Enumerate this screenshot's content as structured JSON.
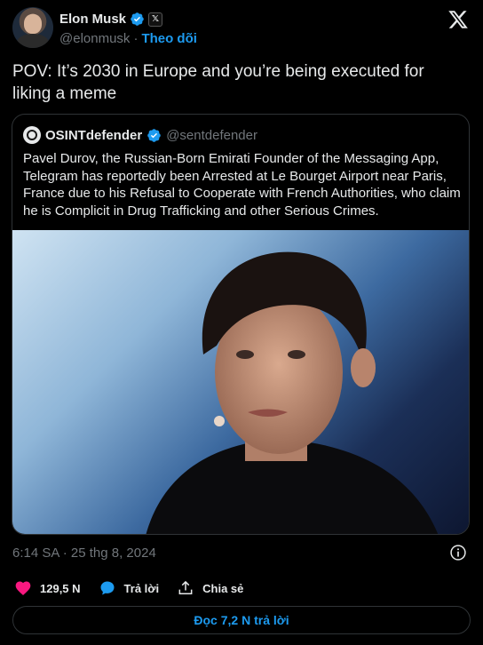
{
  "author": {
    "name": "Elon Musk",
    "handle": "@elonmusk",
    "separator": "·",
    "follow_label": "Theo dõi",
    "affiliation_badge": "𝕏"
  },
  "tweet": {
    "text": "POV: It’s 2030 in Europe and you’re being executed for liking a meme",
    "timestamp": "6:14 SA · 25 thg 8, 2024"
  },
  "quote": {
    "name": "OSINTdefender",
    "handle": "@sentdefender",
    "text": "Pavel Durov, the Russian-Born Emirati Founder of the Messaging App, Telegram has reportedly been Arrested at Le Bourget Airport near Paris, France due to his Refusal to Cooperate with French Authorities, who claim he is Complicit in Drug Trafficking and other Serious Crimes."
  },
  "actions": {
    "likes": "129,5 N",
    "reply_label": "Trả lời",
    "share_label": "Chia sẻ"
  },
  "read_replies_label": "Đọc 7,2 N trả lời",
  "colors": {
    "accent": "#1d9bf0",
    "like": "#f91880",
    "muted": "#71767b",
    "border": "#2f3336",
    "background": "#000000"
  },
  "icons": [
    "verified-badge-icon",
    "x-logo-icon",
    "info-icon",
    "heart-icon",
    "reply-bubble-icon",
    "share-icon"
  ]
}
